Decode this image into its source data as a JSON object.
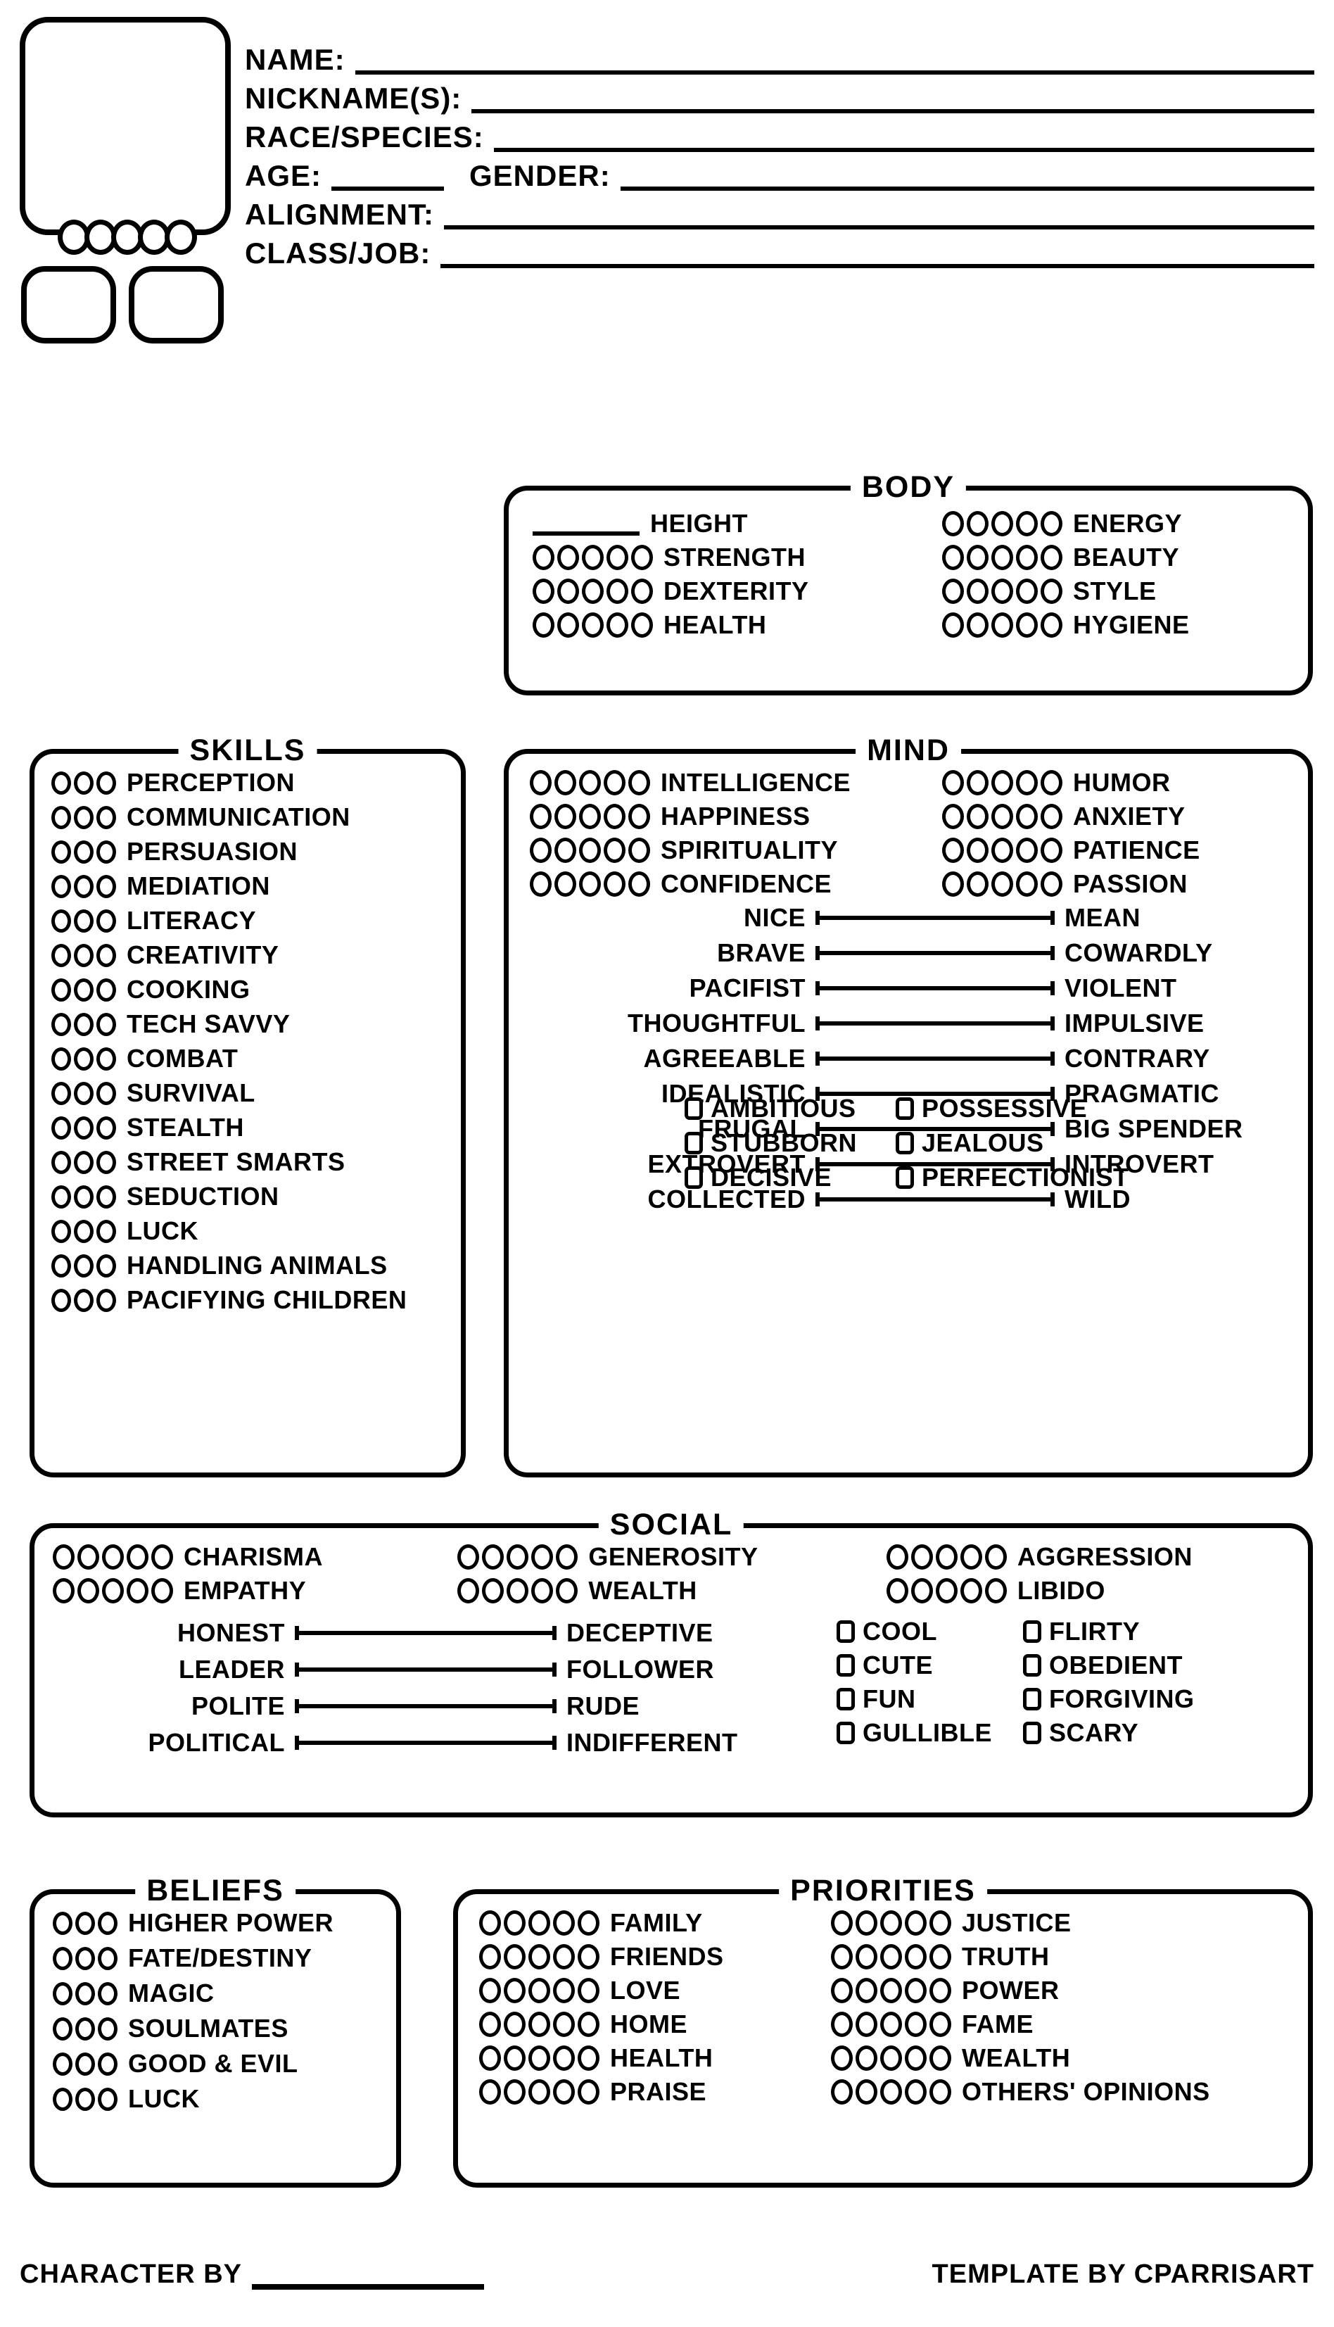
{
  "header": {
    "fields": [
      {
        "label": "NAME:",
        "value": "",
        "line": "long"
      },
      {
        "label": "NICKNAME(S):",
        "value": "",
        "line": "long"
      },
      {
        "label": "RACE/SPECIES:",
        "value": "",
        "line": "long"
      },
      {
        "label": "AGE:",
        "value": "",
        "line": "short",
        "label2": "GENDER:",
        "value2": "",
        "line2": "long"
      },
      {
        "label": "ALIGNMENT:",
        "value": "",
        "line": "long"
      },
      {
        "label": "CLASS/JOB:",
        "value": "",
        "line": "long"
      }
    ]
  },
  "portrait": {
    "bead_count": 5
  },
  "body": {
    "title": "BODY",
    "left": [
      {
        "label": "HEIGHT",
        "type": "line"
      },
      {
        "label": "STRENGTH",
        "pips": 5
      },
      {
        "label": "DEXTERITY",
        "pips": 5
      },
      {
        "label": "HEALTH",
        "pips": 5
      }
    ],
    "right": [
      {
        "label": "ENERGY",
        "pips": 5
      },
      {
        "label": "BEAUTY",
        "pips": 5
      },
      {
        "label": "STYLE",
        "pips": 5
      },
      {
        "label": "HYGIENE",
        "pips": 5
      }
    ]
  },
  "skills": {
    "title": "SKILLS",
    "items": [
      {
        "label": "PERCEPTION",
        "pips": 3
      },
      {
        "label": "COMMUNICATION",
        "pips": 3
      },
      {
        "label": "PERSUASION",
        "pips": 3
      },
      {
        "label": "MEDIATION",
        "pips": 3
      },
      {
        "label": "LITERACY",
        "pips": 3
      },
      {
        "label": "CREATIVITY",
        "pips": 3
      },
      {
        "label": "COOKING",
        "pips": 3
      },
      {
        "label": "TECH SAVVY",
        "pips": 3
      },
      {
        "label": "COMBAT",
        "pips": 3
      },
      {
        "label": "SURVIVAL",
        "pips": 3
      },
      {
        "label": "STEALTH",
        "pips": 3
      },
      {
        "label": "STREET SMARTS",
        "pips": 3
      },
      {
        "label": "SEDUCTION",
        "pips": 3
      },
      {
        "label": "LUCK",
        "pips": 3
      },
      {
        "label": "HANDLING ANIMALS",
        "pips": 3
      },
      {
        "label": "PACIFYING CHILDREN",
        "pips": 3
      }
    ]
  },
  "mind": {
    "title": "MIND",
    "left": [
      {
        "label": "INTELLIGENCE",
        "pips": 5
      },
      {
        "label": "HAPPINESS",
        "pips": 5
      },
      {
        "label": "SPIRITUALITY",
        "pips": 5
      },
      {
        "label": "CONFIDENCE",
        "pips": 5
      }
    ],
    "right": [
      {
        "label": "HUMOR",
        "pips": 5
      },
      {
        "label": "ANXIETY",
        "pips": 5
      },
      {
        "label": "PATIENCE",
        "pips": 5
      },
      {
        "label": "PASSION",
        "pips": 5
      }
    ],
    "spectrums": [
      {
        "left": "NICE",
        "right": "MEAN"
      },
      {
        "left": "BRAVE",
        "right": "COWARDLY"
      },
      {
        "left": "PACIFIST",
        "right": "VIOLENT"
      },
      {
        "left": "THOUGHTFUL",
        "right": "IMPULSIVE"
      },
      {
        "left": "AGREEABLE",
        "right": "CONTRARY"
      },
      {
        "left": "IDEALISTIC",
        "right": "PRAGMATIC"
      },
      {
        "left": "FRUGAL",
        "right": "BIG SPENDER"
      },
      {
        "left": "EXTROVERT",
        "right": "INTROVERT"
      },
      {
        "left": "COLLECTED",
        "right": "WILD"
      }
    ],
    "traits": [
      {
        "left": "AMBITIOUS",
        "right": "POSSESSIVE"
      },
      {
        "left": "STUBBORN",
        "right": "JEALOUS"
      },
      {
        "left": "DECISIVE",
        "right": "PERFECTIONIST"
      }
    ]
  },
  "social": {
    "title": "SOCIAL",
    "stats": [
      [
        {
          "label": "CHARISMA",
          "pips": 5
        },
        {
          "label": "GENEROSITY",
          "pips": 5
        },
        {
          "label": "AGGRESSION",
          "pips": 5
        }
      ],
      [
        {
          "label": "EMPATHY",
          "pips": 5
        },
        {
          "label": "WEALTH",
          "pips": 5
        },
        {
          "label": "LIBIDO",
          "pips": 5
        }
      ]
    ],
    "spectrums": [
      {
        "left": "HONEST",
        "right": "DECEPTIVE"
      },
      {
        "left": "LEADER",
        "right": "FOLLOWER"
      },
      {
        "left": "POLITE",
        "right": "RUDE"
      },
      {
        "left": "POLITICAL",
        "right": "INDIFFERENT"
      }
    ],
    "traits": [
      {
        "left": "COOL",
        "right": "FLIRTY"
      },
      {
        "left": "CUTE",
        "right": "OBEDIENT"
      },
      {
        "left": "FUN",
        "right": "FORGIVING"
      },
      {
        "left": "GULLIBLE",
        "right": "SCARY"
      }
    ]
  },
  "beliefs": {
    "title": "BELIEFS",
    "items": [
      {
        "label": "HIGHER POWER",
        "pips": 3
      },
      {
        "label": "FATE/DESTINY",
        "pips": 3
      },
      {
        "label": "MAGIC",
        "pips": 3
      },
      {
        "label": "SOULMATES",
        "pips": 3
      },
      {
        "label": "GOOD & EVIL",
        "pips": 3
      },
      {
        "label": "LUCK",
        "pips": 3
      }
    ]
  },
  "priorities": {
    "title": "PRIORITIES",
    "left": [
      {
        "label": "FAMILY",
        "pips": 5
      },
      {
        "label": "FRIENDS",
        "pips": 5
      },
      {
        "label": "LOVE",
        "pips": 5
      },
      {
        "label": "HOME",
        "pips": 5
      },
      {
        "label": "HEALTH",
        "pips": 5
      },
      {
        "label": "PRAISE",
        "pips": 5
      }
    ],
    "right": [
      {
        "label": "JUSTICE",
        "pips": 5
      },
      {
        "label": "TRUTH",
        "pips": 5
      },
      {
        "label": "POWER",
        "pips": 5
      },
      {
        "label": "FAME",
        "pips": 5
      },
      {
        "label": "WEALTH",
        "pips": 5
      },
      {
        "label": "OTHERS' OPINIONS",
        "pips": 5
      }
    ]
  },
  "footer": {
    "character_by": "CHARACTER BY",
    "template_by": "TEMPLATE BY CPARRISART"
  },
  "colors": {
    "ink": "#000000",
    "paper": "#ffffff"
  }
}
